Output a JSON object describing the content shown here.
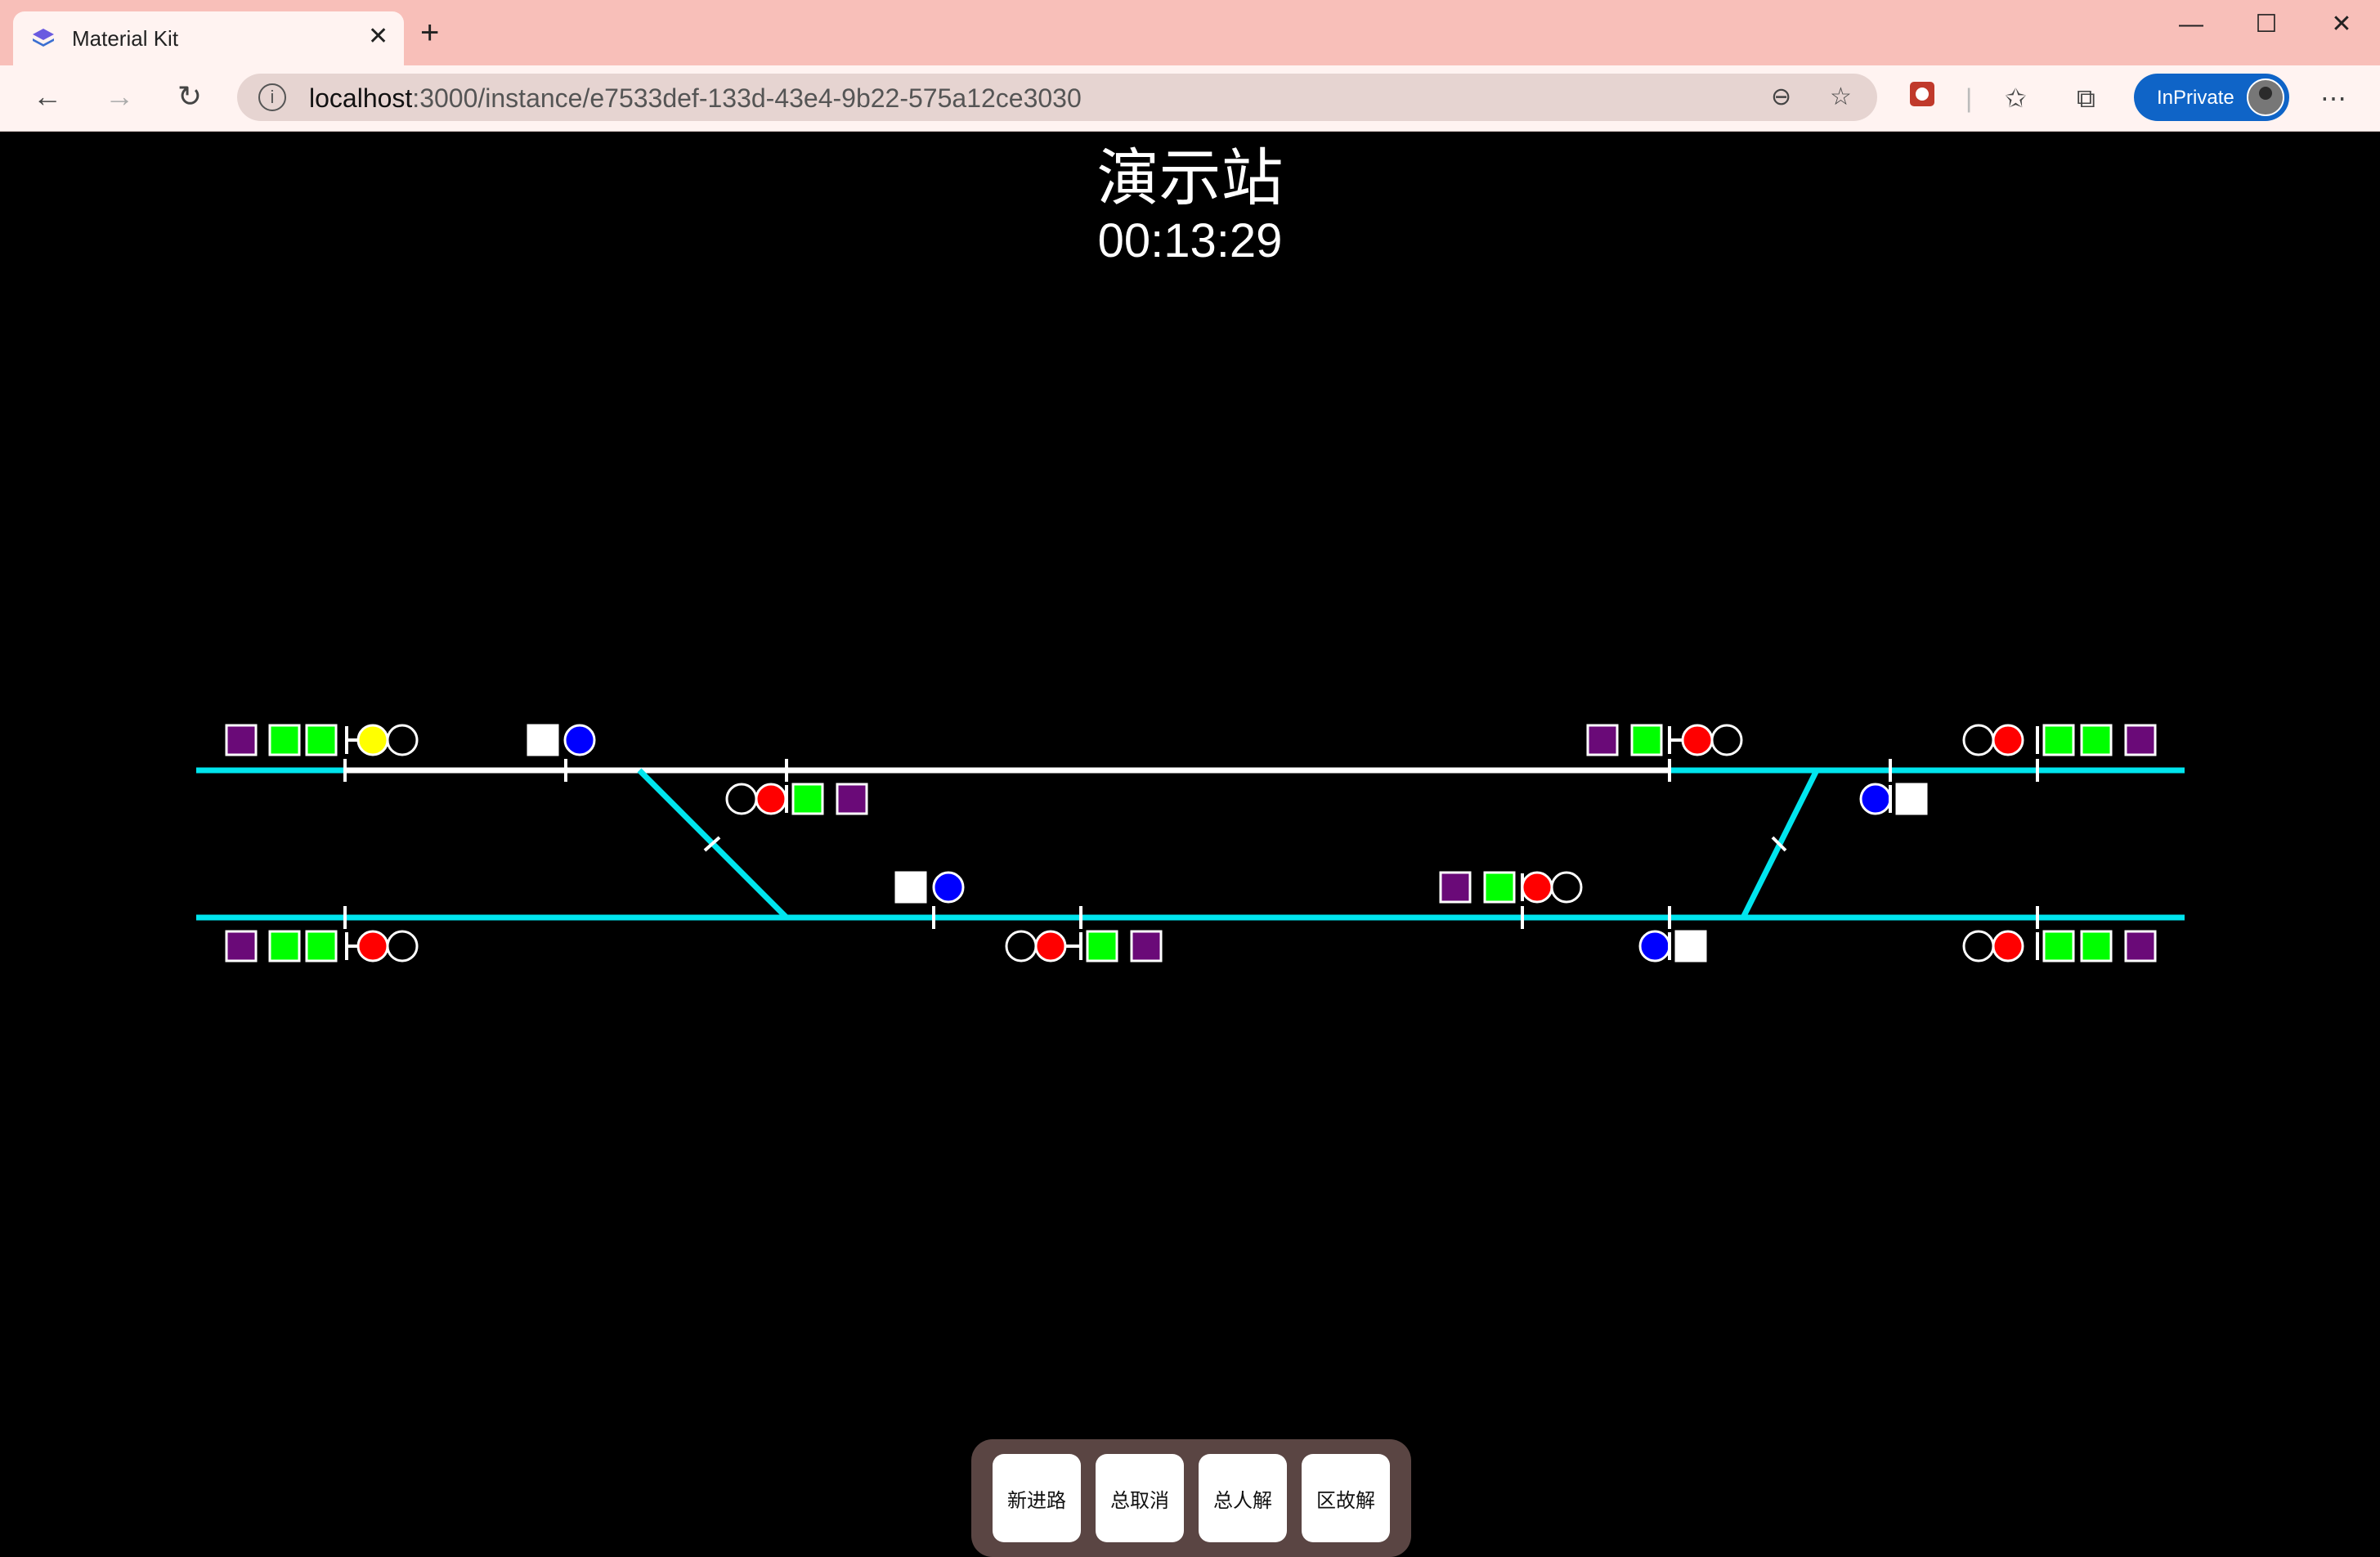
{
  "browser": {
    "tab_title": "Material Kit",
    "url_host": "localhost",
    "url_path": ":3000/instance/e7533def-133d-43e4-9b22-575a12ce3030",
    "inprivate_label": "InPrivate"
  },
  "station": {
    "name": "演示站",
    "clock": "00:13:29"
  },
  "colors": {
    "track": "#00e5ee",
    "route": "#ffffff",
    "green": "#00ff00",
    "red": "#ff0000",
    "yellow": "#ffff00",
    "blue": "#0000ff",
    "purple": "#6a0a78"
  },
  "controls": [
    {
      "label": "新进路"
    },
    {
      "label": "总取消"
    },
    {
      "label": "总人解"
    },
    {
      "label": "区故解"
    }
  ]
}
